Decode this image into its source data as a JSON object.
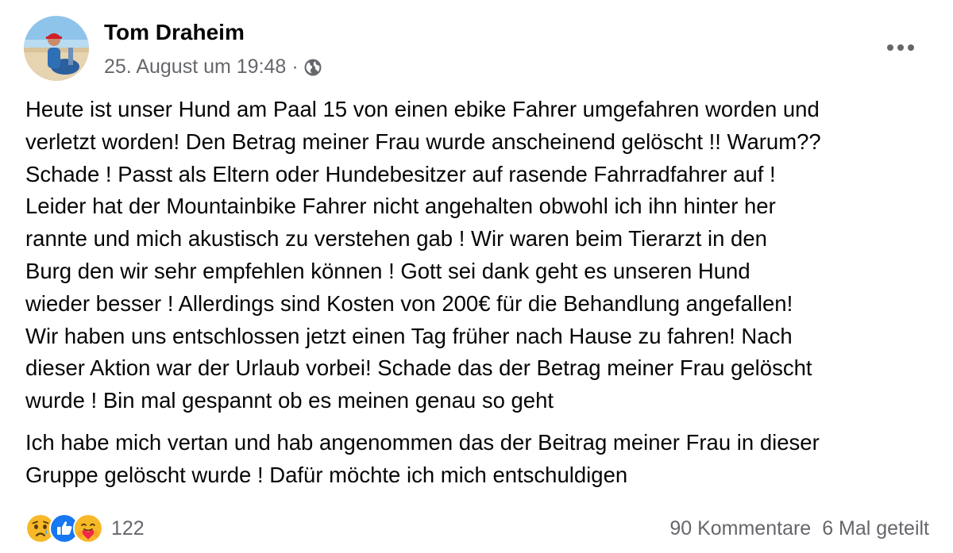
{
  "post": {
    "author": "Tom Draheim",
    "timestamp": "25. August um 19:48",
    "separator": "·",
    "audience_icon": "globe-icon",
    "more_icon": "more-horizontal-icon",
    "paragraphs": [
      "Heute ist unser Hund am Paal 15 von einen ebike Fahrer umgefahren worden und\nverletzt worden! Den Betrag meiner Frau wurde anscheinend gelöscht !! Warum??\nSchade ! Passt als Eltern oder Hundebesitzer auf rasende Fahrradfahrer auf !\nLeider hat der Mountainbike Fahrer nicht angehalten obwohl ich ihn hinter her\nrannte und mich akustisch zu verstehen gab ! Wir waren beim Tierarzt in den\nBurg den wir sehr empfehlen können ! Gott sei dank geht es unseren Hund\nwieder besser ! Allerdings sind Kosten von 200€ für die Behandlung angefallen!\nWir haben uns entschlossen jetzt einen Tag früher nach Hause zu fahren! Nach\ndieser Aktion war der Urlaub vorbei! Schade das der Betrag meiner Frau gelöscht\nwurde ! Bin mal gespannt ob es meinen genau so geht",
      "Ich habe mich vertan und hab angenommen das der Beitrag meiner Frau in dieser\nGruppe gelöscht wurde ! Dafür möchte ich mich entschuldigen"
    ]
  },
  "footer": {
    "reaction_icons": [
      "sad-reaction-icon",
      "like-reaction-icon",
      "care-reaction-icon"
    ],
    "reaction_count": "122",
    "comments": "90 Kommentare",
    "shares": "6 Mal geteilt"
  },
  "colors": {
    "text": "#050505",
    "secondary_text": "#65676b",
    "like_blue": "#1877f2",
    "reaction_yellow": "#f7b928",
    "care_red": "#f0284a"
  }
}
